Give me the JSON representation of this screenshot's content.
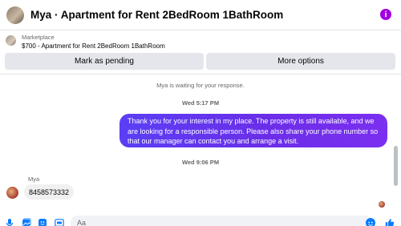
{
  "header": {
    "title": "Mya · Apartment for Rent 2BedRoom 1BathRoom",
    "info_icon": "info-icon"
  },
  "marketplace": {
    "source": "Marketplace",
    "item": "$700 - Apartment for Rent 2BedRoom 1BathRoom",
    "pending_label": "Mark as pending",
    "more_label": "More options"
  },
  "chat": {
    "waiting_text": "Mya is waiting for your response.",
    "timestamp1": "Wed 5:17 PM",
    "outgoing_message": "Thank you for your interest in my place. The property is still available, and we are looking for a responsible person. Please also share your phone number so that our manager can contact you and arrange a visit.",
    "timestamp2": "Wed 9:06 PM",
    "sender_name": "Mya",
    "incoming_message": "8458573332"
  },
  "composer": {
    "placeholder": "Aa",
    "icons": [
      "mic-icon",
      "photo-icon",
      "sticker-icon",
      "gif-icon",
      "emoji-icon",
      "like-icon"
    ]
  },
  "colors": {
    "accent": "#0a7cff",
    "bubble_out_start": "#5a3ff5",
    "bubble_out_end": "#7b2ff0",
    "info": "#a200e0"
  }
}
